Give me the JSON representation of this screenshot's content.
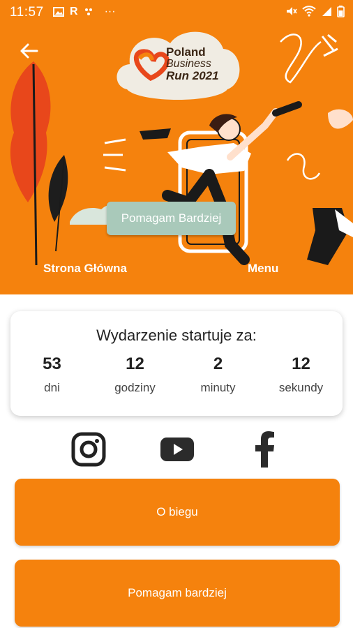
{
  "status_bar": {
    "time": "11:57",
    "left_icons": [
      "image-icon",
      "r-icon",
      "dots-icon",
      "more-icon"
    ],
    "right_icons": [
      "mute-icon",
      "wifi-icon",
      "signal-icon",
      "battery-icon"
    ]
  },
  "header": {
    "logo": {
      "line1": "Poland",
      "line2": "Business",
      "line3": "Run 2021"
    },
    "help_button": "Pomagam Bardziej",
    "nav_home": "Strona Główna",
    "nav_menu": "Menu"
  },
  "countdown": {
    "title": "Wydarzenie startuje za:",
    "units": [
      {
        "value": "53",
        "label": "dni"
      },
      {
        "value": "12",
        "label": "godziny"
      },
      {
        "value": "2",
        "label": "minuty"
      },
      {
        "value": "12",
        "label": "sekundy"
      }
    ]
  },
  "social": [
    "instagram-icon",
    "youtube-icon",
    "facebook-icon"
  ],
  "buttons": {
    "about": "O biegu",
    "help": "Pomagam bardziej"
  },
  "colors": {
    "brand_orange": "#F5820D",
    "pill_green": "#A9C9BA",
    "text_dark": "#222222"
  }
}
